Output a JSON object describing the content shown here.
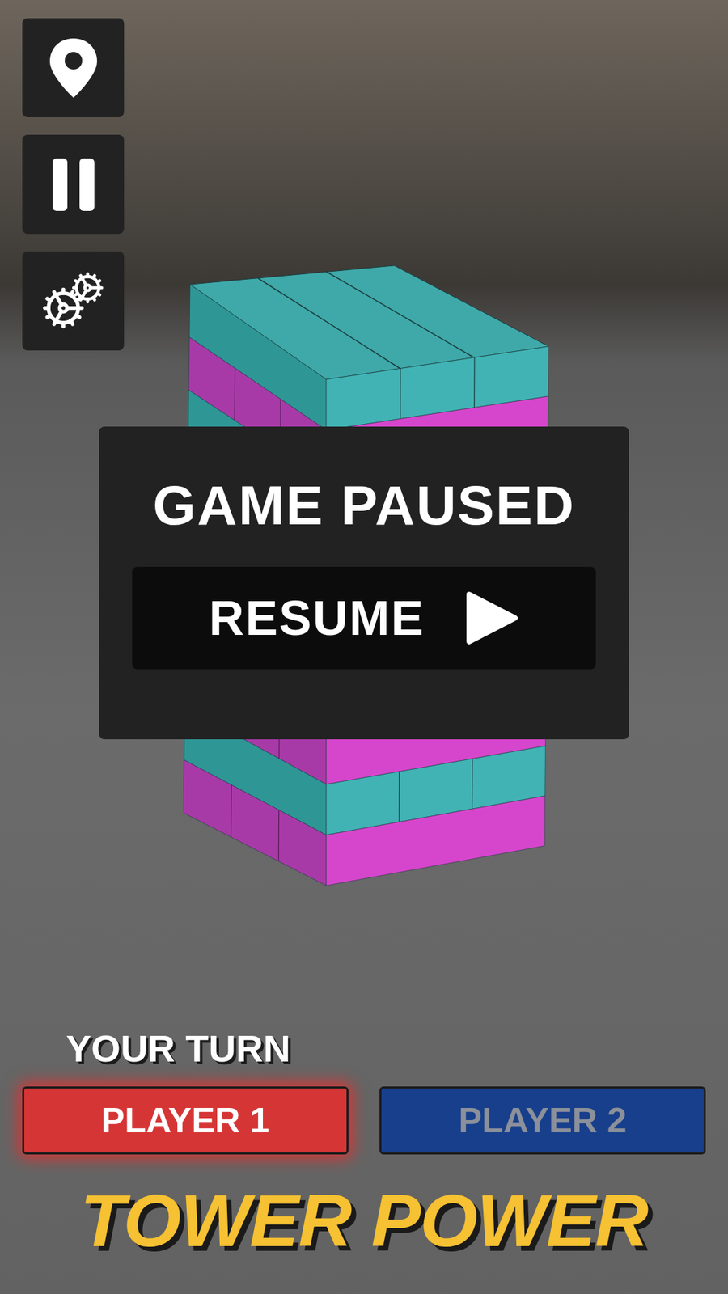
{
  "pause_dialog": {
    "title": "GAME PAUSED",
    "resume_button": {
      "label": "RESUME"
    }
  },
  "turn_label": "YOUR TURN",
  "players": [
    {
      "label": "PLAYER 1",
      "selected": true,
      "color": "#d63535"
    },
    {
      "label": "PLAYER 2",
      "selected": false,
      "color": "#173f8c"
    }
  ],
  "logo": "TOWER POWER"
}
